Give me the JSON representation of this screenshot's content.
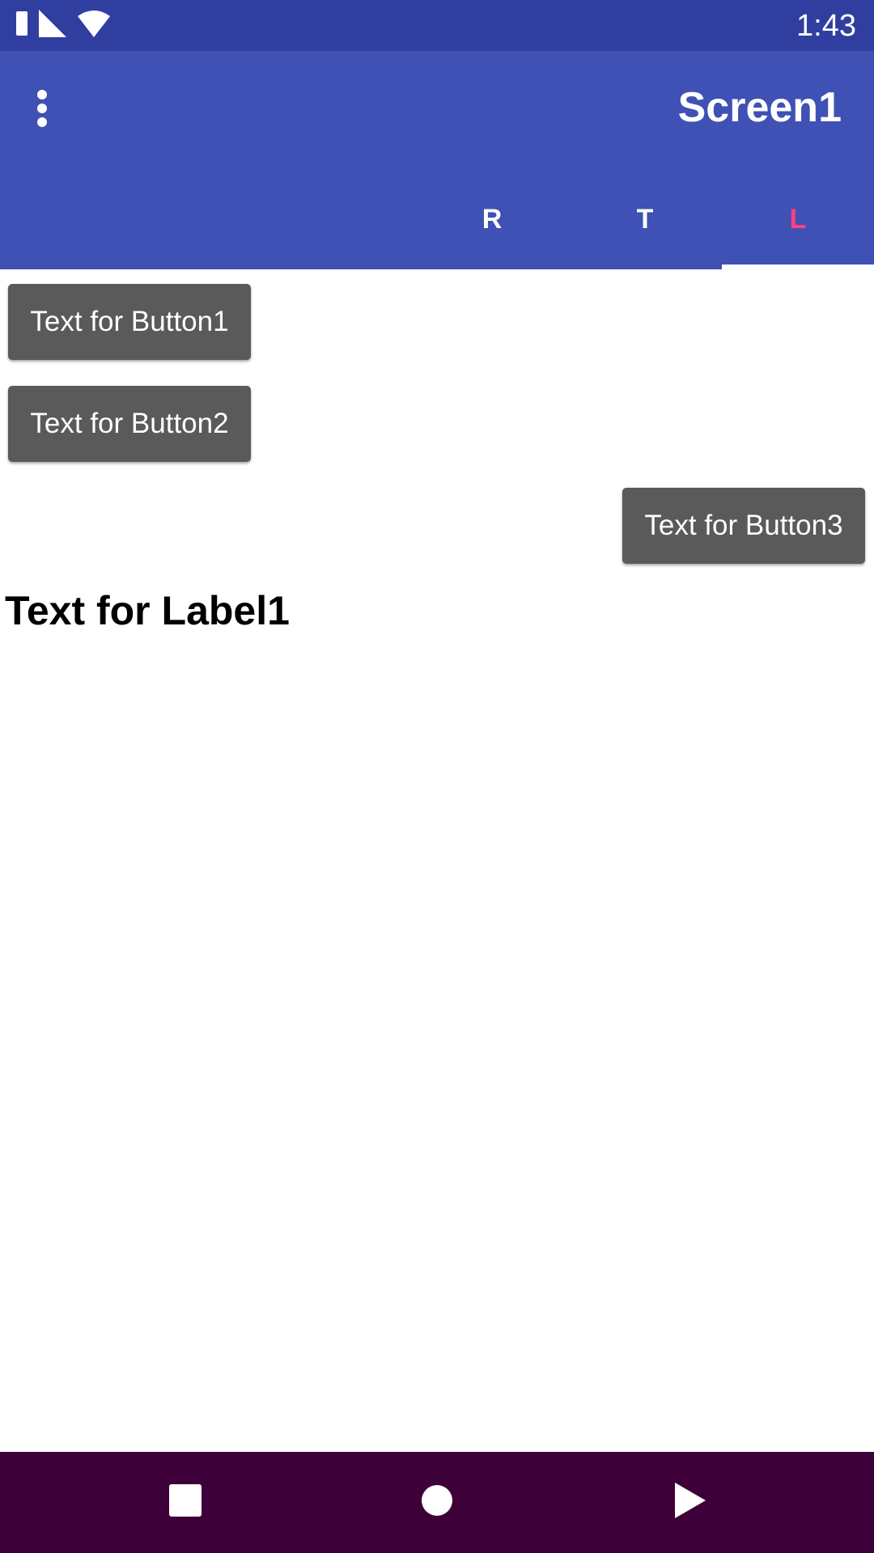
{
  "status_bar": {
    "time": "1:43",
    "icons": [
      "sim-card-icon",
      "signal-icon",
      "wifi-icon"
    ]
  },
  "app_bar": {
    "title": "Screen1",
    "menu_icon": "overflow-menu-icon"
  },
  "tabs": [
    {
      "label": "R"
    },
    {
      "label": "T"
    },
    {
      "label": "L",
      "selected": true
    }
  ],
  "buttons": {
    "button1": "Text for Button1",
    "button2": "Text for Button2",
    "button3": "Text for Button3"
  },
  "label1": "Text for Label1",
  "nav_bar": {
    "icons": [
      "recents-square-icon",
      "home-circle-icon",
      "back-triangle-icon"
    ]
  },
  "colors": {
    "status_bar": "#303f9f",
    "app_bar": "#3f51b5",
    "accent": "#ff4081",
    "button": "#5a5a5a",
    "nav_bar": "#3d0038"
  }
}
